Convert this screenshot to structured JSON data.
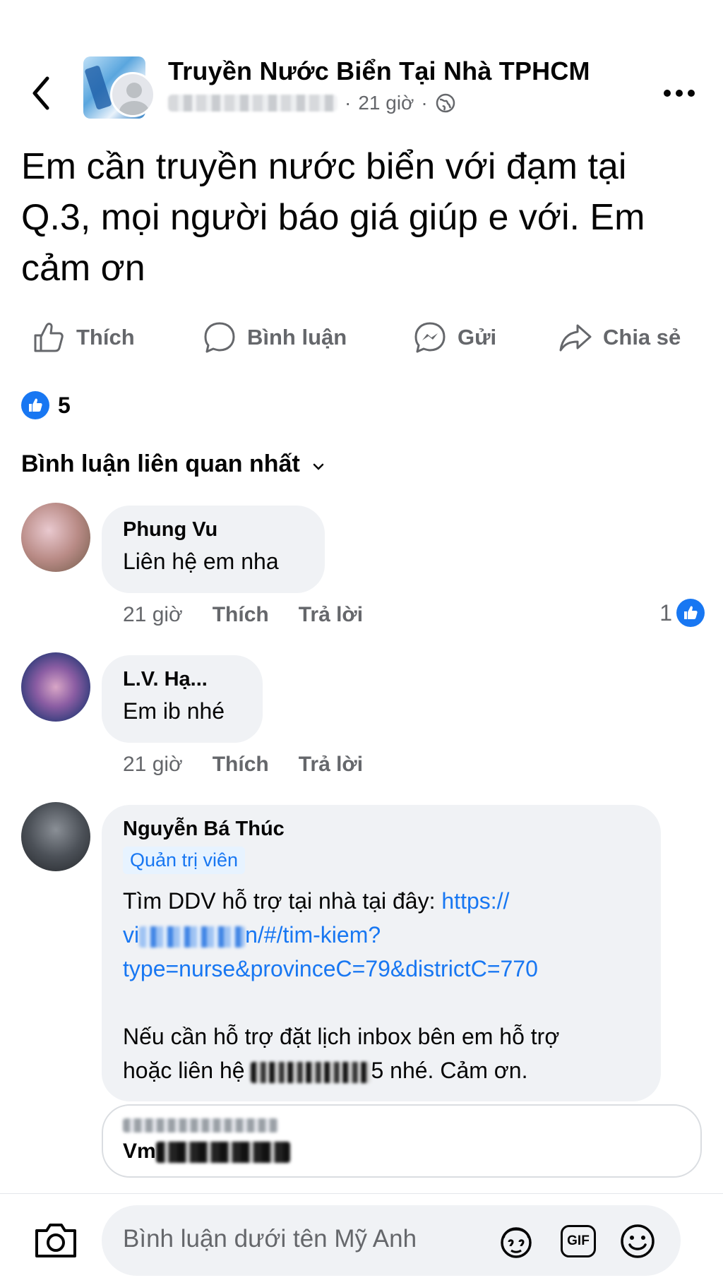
{
  "header": {
    "group_name": "Truyền Nước Biển Tại Nhà TPHCM",
    "time": "21 giờ",
    "separator": "·"
  },
  "post": {
    "text": "Em cần truyền nước biển với đạm tại Q.3, mọi người báo giá giúp e với. Em cảm ơn"
  },
  "actions": {
    "like": "Thích",
    "comment": "Bình luận",
    "send": "Gửi",
    "share": "Chia sẻ"
  },
  "reactions": {
    "count": "5"
  },
  "comments_sort": {
    "label": "Bình luận liên quan nhất"
  },
  "comments": [
    {
      "name": "Phung Vu",
      "text": "Liên hệ em nha",
      "time": "21 giờ",
      "like": "Thích",
      "reply": "Trả lời",
      "likes": "1"
    },
    {
      "name": "L.V. Hạ...",
      "text": "Em ib nhé",
      "time": "21 giờ",
      "like": "Thích",
      "reply": "Trả lời"
    },
    {
      "name": "Nguyễn Bá Thúc",
      "badge": "Quản trị viên",
      "text_intro": "Tìm DDV hỗ trợ tại nhà tại đây: ",
      "link_start": "https://",
      "link_mid_a": "vi",
      "link_mid_b": "n/#/tim-kiem?",
      "link_end": "type=nurse&provinceC=79&districtC=770",
      "text_follow_a": "Nếu cần hỗ trợ đặt lịch inbox bên em hỗ trợ",
      "text_follow_b": "hoặc liên hệ ",
      "text_follow_c": "5 nhé. Cảm ơn.",
      "preview_title": "Vm"
    }
  ],
  "composer": {
    "placeholder": "Bình luận dưới tên Mỹ Anh",
    "gif_label": "GIF"
  },
  "colors": {
    "accent": "#1877f2",
    "bubble": "#f0f2f5",
    "muted": "#65676b"
  }
}
